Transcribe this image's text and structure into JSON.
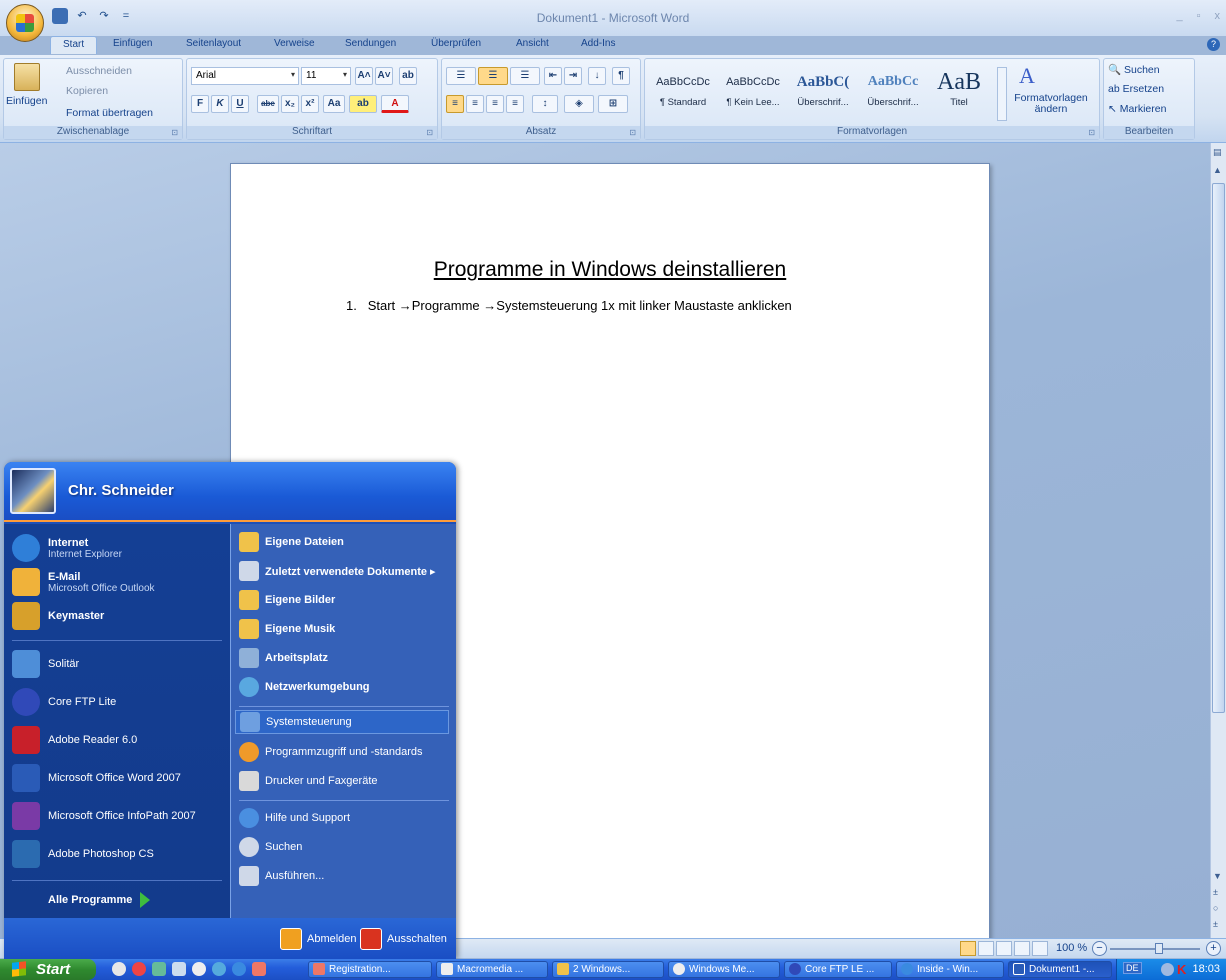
{
  "window": {
    "title": "Dokument1 - Microsoft Word",
    "controls": [
      "_",
      "▫",
      "x"
    ]
  },
  "qat": {
    "save": "💾",
    "undo": "↶",
    "redo": "↷",
    "more": "="
  },
  "tabs": [
    "Start",
    "Einfügen",
    "Seitenlayout",
    "Verweise",
    "Sendungen",
    "Überprüfen",
    "Ansicht",
    "Add-Ins"
  ],
  "ribbon": {
    "clipboard": {
      "label": "Zwischenablage",
      "paste": "Einfügen",
      "cut": "Ausschneiden",
      "copy": "Kopieren",
      "format_painter": "Format übertragen"
    },
    "font": {
      "label": "Schriftart",
      "font_name": "Arial",
      "font_size": "11",
      "bold": "F",
      "italic": "K",
      "underline": "U",
      "strike": "abe",
      "sub": "x₂",
      "sup": "x²",
      "case": "Aa",
      "grow": "A˄",
      "shrink": "A˅",
      "font_color": "A"
    },
    "paragraph": {
      "label": "Absatz"
    },
    "styles": {
      "label": "Formatvorlagen",
      "items": [
        {
          "preview": "AaBbCcDc",
          "name": "¶ Standard"
        },
        {
          "preview": "AaBbCcDc",
          "name": "¶ Kein Lee..."
        },
        {
          "preview": "AaBbC(",
          "name": "Überschrif..."
        },
        {
          "preview": "AaBbCc",
          "name": "Überschrif..."
        },
        {
          "preview": "AaB",
          "name": "Titel"
        }
      ],
      "change_styles": "Formatvorlagen ändern"
    },
    "editing": {
      "label": "Bearbeiten",
      "find": "Suchen",
      "replace": "Ersetzen",
      "select": "Markieren"
    }
  },
  "document": {
    "title": "Programme in Windows deinstallieren",
    "line1_num": "1.",
    "line1_text": "Start →Programme →Systemsteuerung 1x mit linker Maustaste anklicken"
  },
  "status": {
    "zoom": "100 %"
  },
  "startmenu": {
    "user": "Chr. Schneider",
    "pinned": [
      {
        "title": "Internet",
        "sub": "Internet Explorer",
        "color": "#2f7fd8"
      },
      {
        "title": "E-Mail",
        "sub": "Microsoft Office Outlook",
        "color": "#f0b23a"
      },
      {
        "title": "Keymaster",
        "sub": "",
        "color": "#d7a02b"
      }
    ],
    "recent": [
      {
        "label": "Solitär",
        "color": "#4e8ed8"
      },
      {
        "label": "Core FTP Lite",
        "color": "#3049b8"
      },
      {
        "label": "Adobe Reader 6.0",
        "color": "#c8202a"
      },
      {
        "label": "Microsoft Office Word 2007",
        "color": "#2a5bb7"
      },
      {
        "label": "Microsoft Office InfoPath 2007",
        "color": "#7a3aa6"
      },
      {
        "label": "Adobe Photoshop CS",
        "color": "#2b6bb0"
      }
    ],
    "all_programs": "Alle Programme",
    "right_bold": [
      {
        "label": "Eigene Dateien",
        "color": "#f0c24a"
      },
      {
        "label": "Zuletzt verwendete Dokumente ▸",
        "color": "#cfd8e8"
      },
      {
        "label": "Eigene Bilder",
        "color": "#f0c24a"
      },
      {
        "label": "Eigene Musik",
        "color": "#f0c24a"
      },
      {
        "label": "Arbeitsplatz",
        "color": "#8fb0d8"
      },
      {
        "label": "Netzwerkumgebung",
        "color": "#59a8e0"
      }
    ],
    "right_normal": [
      {
        "label": "Systemsteuerung",
        "color": "#6e9fe0"
      },
      {
        "label": "Programmzugriff und -standards",
        "color": "#f09a2a"
      },
      {
        "label": "Drucker und Faxgeräte",
        "color": "#d9d9d9"
      }
    ],
    "right_bottom": [
      {
        "label": "Hilfe und Support",
        "color": "#4a8fe0"
      },
      {
        "label": "Suchen",
        "color": "#cfd8e8"
      },
      {
        "label": "Ausführen...",
        "color": "#cfd8e8"
      }
    ],
    "logoff": "Abmelden",
    "shutdown": "Ausschalten"
  },
  "taskbar": {
    "start": "Start",
    "tasks": [
      "Registration...",
      "Macromedia ...",
      "2 Windows...",
      "Windows Me...",
      "Core FTP LE ...",
      "Inside - Win...",
      "Dokument1 -..."
    ],
    "lang": "DE",
    "clock": "18:03"
  }
}
